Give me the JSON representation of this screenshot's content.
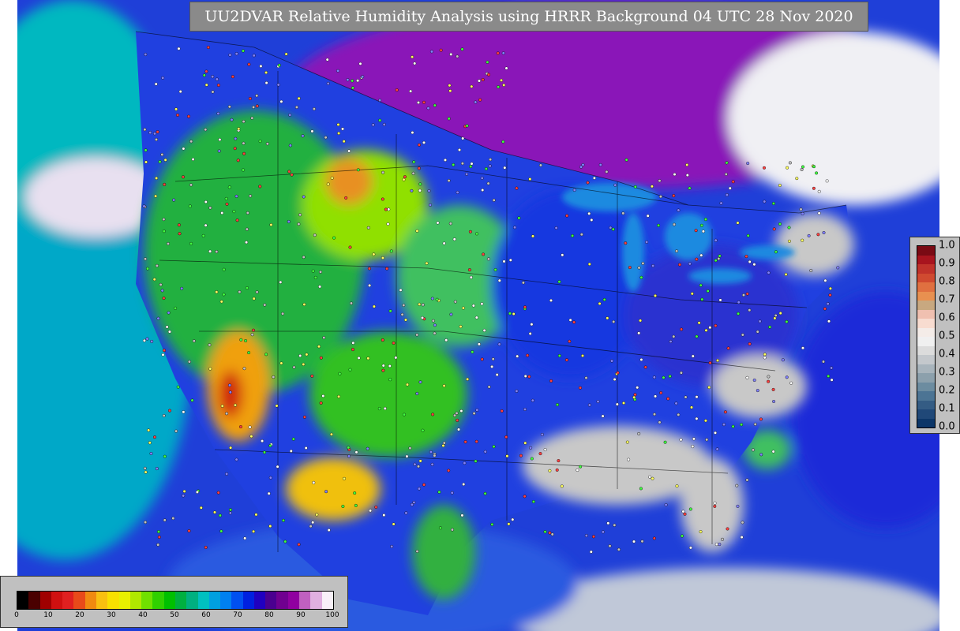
{
  "title": "UU2DVAR Relative Humidity Analysis using HRRR Background 04 UTC 28 Nov 2020",
  "colorbar_bottom": {
    "ticks": [
      "0",
      "10",
      "20",
      "30",
      "40",
      "50",
      "60",
      "70",
      "80",
      "90",
      "100"
    ],
    "colors": [
      "#000000",
      "#4a0000",
      "#a00000",
      "#d01010",
      "#e02020",
      "#e84a1a",
      "#f08a10",
      "#f8c010",
      "#f8e000",
      "#e8f000",
      "#b0e800",
      "#70e000",
      "#30d000",
      "#00c000",
      "#00b040",
      "#00b080",
      "#00c0c0",
      "#00a0e0",
      "#0080f0",
      "#0050f0",
      "#0020e0",
      "#2000c0",
      "#4a0090",
      "#700090",
      "#9000a0",
      "#c060c0",
      "#e0b0e0",
      "#f8f0f8"
    ]
  },
  "colorbar_side": {
    "ticks": [
      "1.0",
      "0.9",
      "0.8",
      "0.7",
      "0.6",
      "0.5",
      "0.4",
      "0.3",
      "0.2",
      "0.1",
      "0.0"
    ],
    "colors": [
      "#7a0a14",
      "#a8141e",
      "#c0322a",
      "#d04a30",
      "#e07040",
      "#e89050",
      "#c8a880",
      "#f0c0b0",
      "#f8dcd0",
      "#f4ece8",
      "#f0f0f0",
      "#dcdcdc",
      "#c4c8cc",
      "#a8b4bc",
      "#8ca0ac",
      "#6c8ca0",
      "#4c7494",
      "#345c84",
      "#204878",
      "#0c3668"
    ]
  },
  "map": {
    "ocean_color": "#1f3fd8",
    "land_colors": [
      "#00b050",
      "#30d020",
      "#90e000",
      "#f0c010",
      "#e04010",
      "#00a0c0",
      "#1030e0",
      "#7010b0",
      "#c8c8c8"
    ]
  }
}
